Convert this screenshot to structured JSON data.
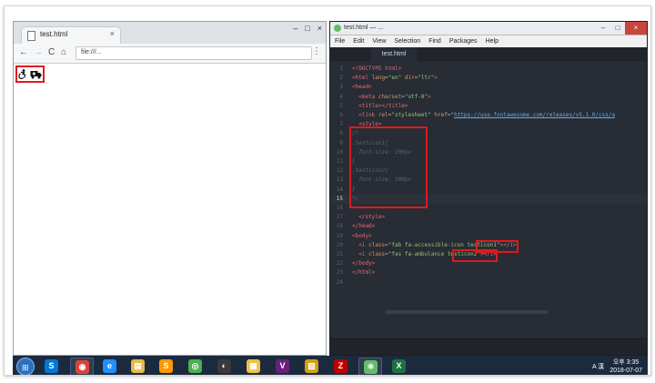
{
  "chrome": {
    "tab_title": "test.html",
    "tab_close": "×",
    "url": "file:///...",
    "win_controls": [
      "–",
      "□",
      "×"
    ],
    "nav": {
      "back": "←",
      "forward": "→",
      "reload": "C",
      "home": "⌂"
    },
    "menu": "⋮",
    "rendered_icons": [
      "accessible-icon",
      "ambulance-icon"
    ]
  },
  "atom": {
    "title": "test.html — ...",
    "win_controls": [
      "–",
      "□",
      "×"
    ],
    "menu": [
      "File",
      "Edit",
      "View",
      "Selection",
      "Find",
      "Packages",
      "Help"
    ],
    "tab": "test.html",
    "lines": [
      {
        "n": "1",
        "html": "<span class=\"tag\">&lt;!DOCTYPE html&gt;</span>"
      },
      {
        "n": "2",
        "html": "<span class=\"tag\">&lt;html</span> <span class=\"att\">lang</span>=<span class=\"str\">\"en\"</span> <span class=\"att\">dir</span>=<span class=\"str\">\"ltr\"</span><span class=\"tag\">&gt;</span>"
      },
      {
        "n": "3",
        "html": "<span class=\"tag\">&lt;head&gt;</span>"
      },
      {
        "n": "4",
        "html": "  <span class=\"tag\">&lt;meta</span> <span class=\"att\">charset</span>=<span class=\"str\">\"utf-8\"</span><span class=\"tag\">&gt;</span>"
      },
      {
        "n": "5",
        "html": "  <span class=\"tag\">&lt;title&gt;&lt;/title&gt;</span>"
      },
      {
        "n": "6",
        "html": "  <span class=\"tag\">&lt;link</span> <span class=\"att\">rel</span>=<span class=\"str\">\"stylesheet\"</span> <span class=\"att\">href</span>=<span class=\"str\">\"</span><span class=\"lnk\">https://use.fontawesome.com/releases/v5.1.0/css/a</span>"
      },
      {
        "n": "7",
        "html": "  <span class=\"tag\">&lt;style&gt;</span>"
      },
      {
        "n": "8",
        "html": "<span class=\"com\">/*</span>"
      },
      {
        "n": "9",
        "html": "<span class=\"com\">.testicon1{</span>"
      },
      {
        "n": "10",
        "html": "<span class=\"com\">  font-size: 200px</span>"
      },
      {
        "n": "11",
        "html": "<span class=\"com\">}</span>"
      },
      {
        "n": "12",
        "html": "<span class=\"com\">.testicon2{</span>"
      },
      {
        "n": "13",
        "html": "<span class=\"com\">  font-size: 300px</span>"
      },
      {
        "n": "14",
        "html": "<span class=\"com\">}</span>"
      },
      {
        "n": "15",
        "html": "<span class=\"com\">*/</span>"
      },
      {
        "n": "16",
        "html": ""
      },
      {
        "n": "17",
        "html": "  <span class=\"tag\">&lt;/style&gt;</span>"
      },
      {
        "n": "18",
        "html": "<span class=\"tag\">&lt;/head&gt;</span>"
      },
      {
        "n": "19",
        "html": "<span class=\"tag\">&lt;body&gt;</span>"
      },
      {
        "n": "20",
        "html": "  <span class=\"tag\">&lt;i</span> <span class=\"att\">class</span>=<span class=\"str\">\"fab fa-accessible-icon testicon1\"</span><span class=\"tag\">&gt;&lt;/i&gt;</span>"
      },
      {
        "n": "21",
        "html": "  <span class=\"tag\">&lt;i</span> <span class=\"att\">class</span>=<span class=\"str\">\"fas fa-ambulance testicon2\"</span><span class=\"tag\">&gt;&lt;/i&gt;</span>"
      },
      {
        "n": "22",
        "html": "<span class=\"tag\">&lt;/body&gt;</span>"
      },
      {
        "n": "23",
        "html": "<span class=\"tag\">&lt;/html&gt;</span>"
      },
      {
        "n": "24",
        "html": ""
      }
    ],
    "active_line": "15"
  },
  "taskbar": {
    "start_glyph": "⊞",
    "apps": [
      {
        "name": "skype",
        "color": "#0078d7",
        "glyph": "S",
        "running": false
      },
      {
        "name": "chrome",
        "color": "#db4437",
        "glyph": "◉",
        "running": true
      },
      {
        "name": "ie",
        "color": "#1e90ff",
        "glyph": "e",
        "running": false
      },
      {
        "name": "explorer",
        "color": "#e8b84a",
        "glyph": "▤",
        "running": false
      },
      {
        "name": "sublime",
        "color": "#ff9800",
        "glyph": "S",
        "running": false
      },
      {
        "name": "app-green",
        "color": "#4caf50",
        "glyph": "◎",
        "running": false
      },
      {
        "name": "app-dark",
        "color": "#3a3a3a",
        "glyph": "◐",
        "running": false
      },
      {
        "name": "paint",
        "color": "#f0c040",
        "glyph": "▦",
        "running": false
      },
      {
        "name": "visual-studio",
        "color": "#68217a",
        "glyph": "V",
        "running": false
      },
      {
        "name": "sql",
        "color": "#d4a017",
        "glyph": "▥",
        "running": false
      },
      {
        "name": "filezilla",
        "color": "#bf0000",
        "glyph": "Z",
        "running": false
      },
      {
        "name": "atom",
        "color": "#66bb6a",
        "glyph": "⚛",
        "running": true
      },
      {
        "name": "excel",
        "color": "#1e7145",
        "glyph": "X",
        "running": false
      }
    ],
    "tray_text": "A 漢",
    "clock_time": "오후 3:35",
    "clock_date": "2018-07-07"
  }
}
